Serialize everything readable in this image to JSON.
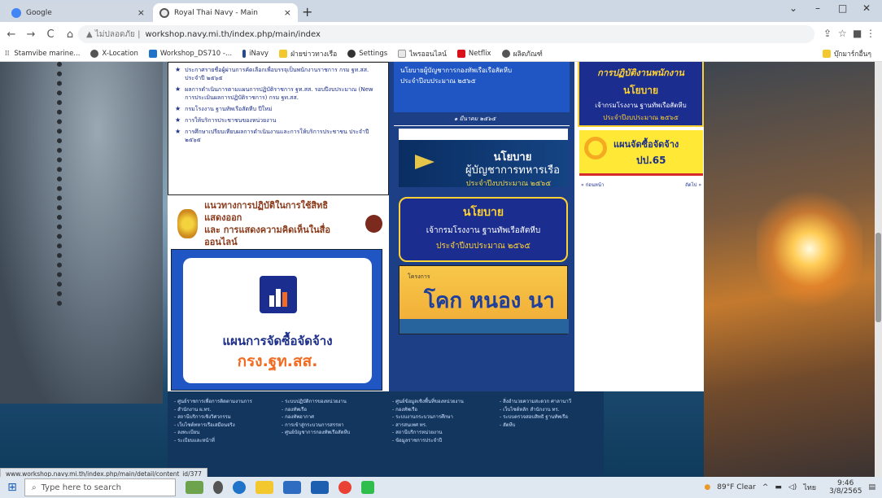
{
  "browser": {
    "tabs": [
      {
        "label": "Google",
        "close": "×"
      },
      {
        "label": "Royal Thai Navy - Main",
        "close": "×"
      }
    ],
    "new_tab": "+",
    "window": {
      "min": "–",
      "max": "□",
      "close": "✕",
      "chev": "⌄"
    },
    "nav": {
      "back": "←",
      "forward": "→",
      "reload": "C",
      "home": "⌂"
    },
    "url_prefix": "▲ ไม่ปลอดภัย |",
    "url": "workshop.navy.mi.th/index.php/main/index",
    "bookmarks": [
      "Stamvibe marine...",
      "X-Location",
      "Workshop_DS710 -...",
      "iNavy",
      "ฝ่ายข่าวทางเรือ",
      "Settings",
      "ไพรออนไลน์",
      "Netflix",
      "ผลิตภัณฑ์"
    ],
    "bookmarks_right": "บุ๊กมาร์กอื่นๆ"
  },
  "news": {
    "items": [
      "ประกาศรายชื่อผู้ผ่านการคัดเลือกเพื่อบรรจุเป็นพนักงานราชการ กรม ฐท.สส. ประจำปี ๒๕๖๕",
      "ผลการดำเนินการตามแผนการปฏิบัติราชการ ฐท.สส. รอบปีงบประมาณ (New การประเมินผลการปฏิบัติราชการ) กรม ฐท.สส.",
      "กรมโรงงาน ฐานทัพเรือสัตหีบ ปีใหม่",
      "การให้บริการประชาชนของหน่วยงาน",
      "การศึกษาเปรียบเทียบผลการดำเนินงานและการให้บริการประชาชน ประจำปี ๒๕๖๕"
    ]
  },
  "rights_banner": {
    "line1": "แนวทางการปฏิบัติในการใช้สิทธิแสดงออก",
    "line2": "และ การแสดงความคิดเห็นในสื่อออนไลน์"
  },
  "procurement": {
    "title": "แผนการจัดซื้อจัดจ้าง",
    "org": "กรง.ฐท.สส."
  },
  "mid": {
    "top_line1": "นโยบายผู้บัญชาการกองทัพเรือเรือสัตหีบ",
    "top_line2": "ประจำปีงบประมาณ ๒๕๖๕",
    "date": "๑ มีนาคม ๒๕๖๕",
    "policy1": {
      "a": "นโยบาย",
      "b": "ผู้บัญชาการทหารเรือ",
      "c": "ประจำปีงบประมาณ ๒๕๖๕"
    },
    "policy2": {
      "a": "นโยบาย",
      "b": "เจ้ากรมโรงงาน ฐานทัพเรือสัตหีบ",
      "c": "ประจำปีงบประมาณ ๒๕๖๕"
    },
    "project": {
      "label": "โครงการ",
      "title": "โคก หนอง นา"
    }
  },
  "right": {
    "header": "การปฏิบัติงานพนักงาน",
    "policy": {
      "a": "นโยบาย",
      "b": "เจ้ากรมโรงงาน ฐานทัพเรือสัตหีบ",
      "c": "ประจำปีงบประมาณ ๒๕๖๕"
    },
    "plan": {
      "t1": "แผนจัดซื้อจัดจ้าง",
      "t2": "ปป.65"
    },
    "prev": "« ก่อนหน้า",
    "next": "ถัดไป »"
  },
  "footer": {
    "cols": [
      [
        "- ศูนย์ราชการเพื่อการติดตามงานการ",
        "- สำนักงาน ผ.ทร.",
        "- สถานีบริการเชิงวิศวกรรม",
        "- เว็บไซต์ทหารเรือเสมือนจริง",
        "- ลงทะเบียน",
        "- ระเบียบและหน้าที่"
      ],
      [
        "- ระบบปฏิบัติการของหน่วยงาน",
        "- กองทัพเรือ",
        "- กองทัพอากาศ",
        "- การเข้าสู่กระบวนการสรรหา",
        "- ศูนย์บัญชาการกองทัพเรือสัตหีบ"
      ],
      [
        "- ศูนย์ข้อมูลเชิงพื้นที่ของหน่วยงาน",
        "- กองทัพเรือ",
        "- ระบบงานกระบวนการศึกษา",
        "- สารสนเทศ ทร.",
        "- สถานีบริการหน่วยงาน",
        "- ข้อมูลราชการประจำปี"
      ],
      [
        "- สิ่งอำนวยความสะดวก ศาลานาวี",
        "- เว็บไซต์หลัก สำนักงาน ทร.",
        "- ระบบตรวจสอบสิทธิ ฐานทัพเรือ",
        "- สัตหีบ"
      ]
    ]
  },
  "status_url": "www.workshop.navy.mi.th/index.php/main/detail/content_id/377",
  "taskbar": {
    "search_placeholder": "Type here to search",
    "weather": "89°F Clear",
    "time": "9:46",
    "date": "3/8/2565",
    "lang": "ไทย"
  }
}
